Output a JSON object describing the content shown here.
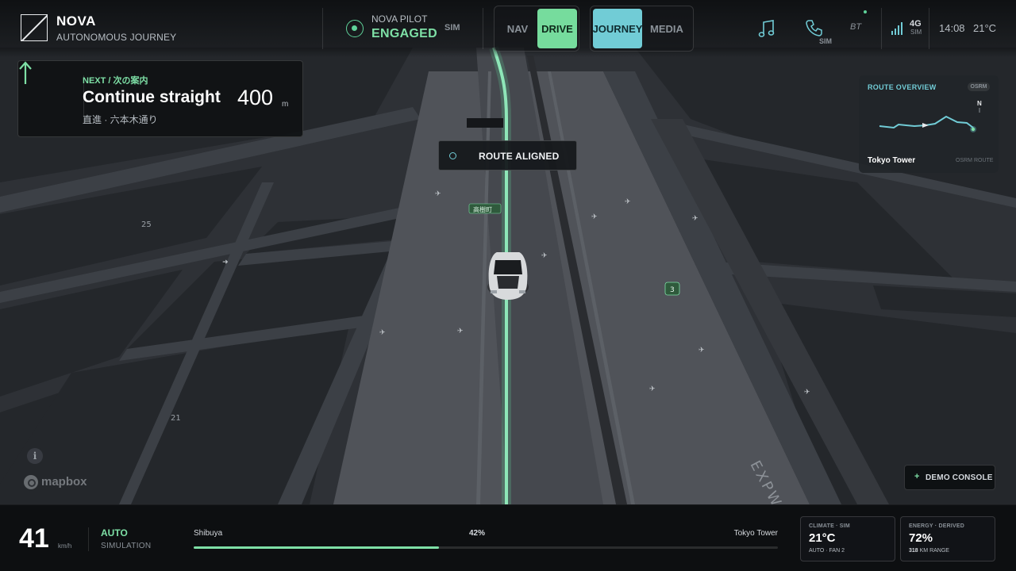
{
  "brand": {
    "name": "NOVA",
    "subtitle": "AUTONOMOUS JOURNEY"
  },
  "pilot": {
    "label": "NOVA PILOT",
    "status": "ENGAGED",
    "mode": "SIM"
  },
  "view_toggle": {
    "nav": "NAV",
    "drive": "DRIVE",
    "active": "DRIVE"
  },
  "panel_toggle": {
    "journey": "JOURNEY",
    "media": "MEDIA",
    "active": "JOURNEY"
  },
  "status_bar": {
    "music_icon": "music-note-icon",
    "phone_icon": "phone-icon",
    "phone_sub": "SIM",
    "bt": "BT",
    "network": "4G",
    "network_sub": "SIM",
    "time": "14:08",
    "temperature": "21°C"
  },
  "next_turn": {
    "kicker": "NEXT / 次の案内",
    "instruction": "Continue straight",
    "street": "直進 · 六本木通り",
    "distance": "400",
    "unit": "m",
    "icon": "arrow-up-icon"
  },
  "route_status": {
    "label": "ROUTE ALIGNED"
  },
  "route_overview": {
    "title": "ROUTE OVERVIEW",
    "badge": "OSRM",
    "compass": "N",
    "destination": "Tokyo Tower",
    "source": "OSRM ROUTE"
  },
  "map": {
    "labels": {
      "station": "高樹町",
      "route_shield": "3",
      "block_25": "25",
      "block_21": "21",
      "expressway": "EXPWY"
    },
    "attribution": "mapbox",
    "info": "i"
  },
  "demo_console": {
    "icon": "+",
    "label": "DEMO CONSOLE"
  },
  "drive": {
    "speed": "41",
    "speed_unit": "km/h",
    "mode": "AUTO",
    "source": "SIMULATION"
  },
  "trip": {
    "from": "Shibuya",
    "to": "Tokyo Tower",
    "progress_label": "42%",
    "progress": 0.42
  },
  "climate": {
    "label": "CLIMATE · SIM",
    "value": "21°C",
    "sub": "AUTO · FAN 2"
  },
  "energy": {
    "label": "ENERGY · DERIVED",
    "value": "72%",
    "range_value": "318",
    "range_unit": "KM RANGE"
  },
  "colors": {
    "accent_green": "#7ee0a6",
    "accent_cyan": "#71ccd6",
    "route_line": "#8ee6b8"
  }
}
